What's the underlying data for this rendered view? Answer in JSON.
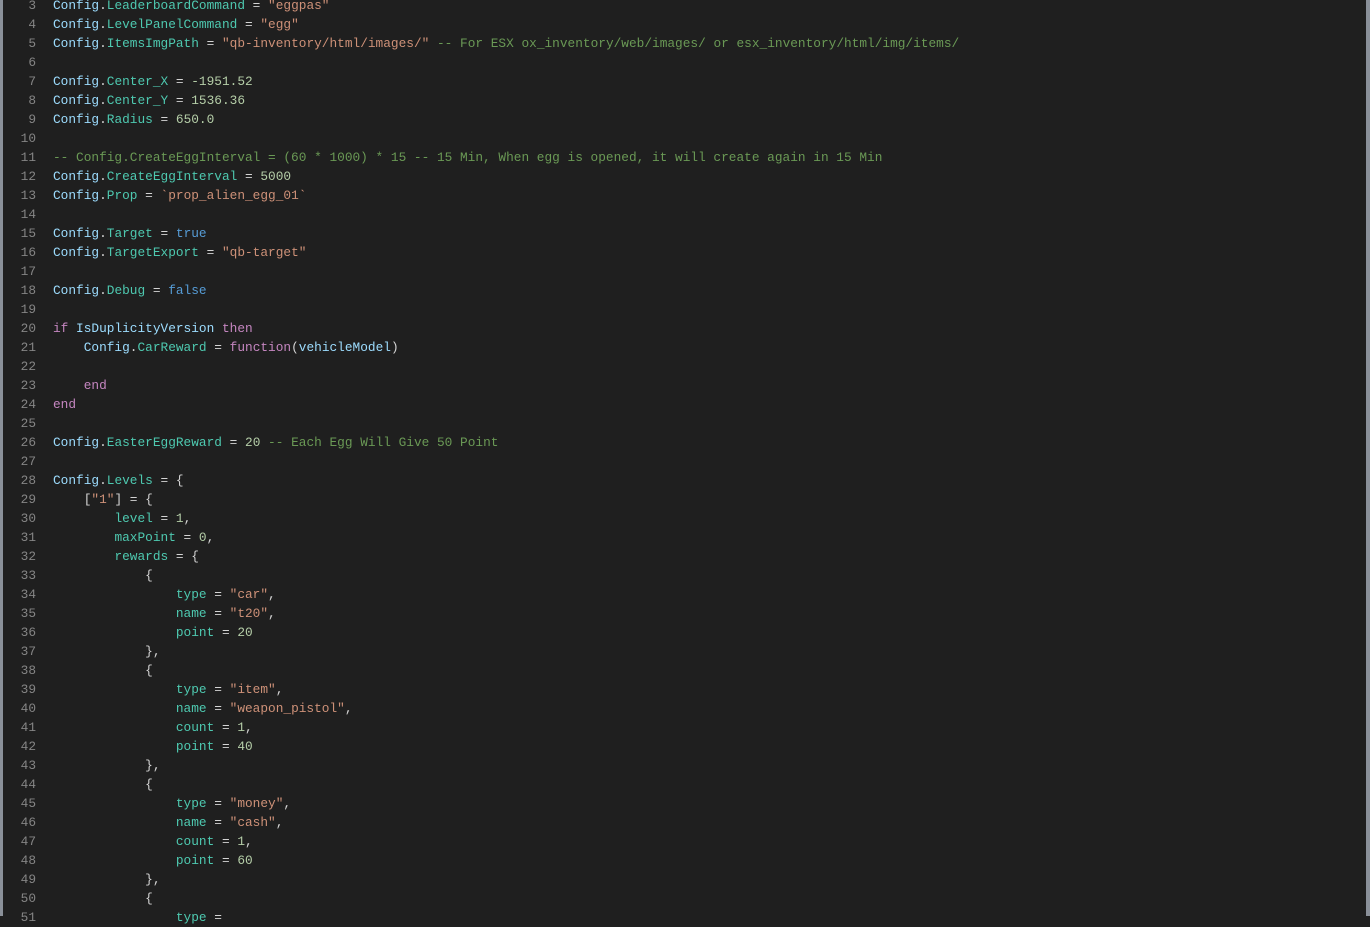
{
  "editor": {
    "first_line_number": 3,
    "lines": [
      [
        [
          "c",
          "Config"
        ],
        [
          "t",
          "."
        ],
        [
          "p",
          "LeaderboardCommand"
        ],
        [
          "t",
          " = "
        ],
        [
          "s",
          "\"eggpas\""
        ]
      ],
      [
        [
          "c",
          "Config"
        ],
        [
          "t",
          "."
        ],
        [
          "p",
          "LevelPanelCommand"
        ],
        [
          "t",
          " = "
        ],
        [
          "s",
          "\"egg\""
        ]
      ],
      [
        [
          "c",
          "Config"
        ],
        [
          "t",
          "."
        ],
        [
          "p",
          "ItemsImgPath"
        ],
        [
          "t",
          " = "
        ],
        [
          "s",
          "\"qb-inventory/html/images/\""
        ],
        [
          "m",
          " -- For ESX ox_inventory/web/images/ or esx_inventory/html/img/items/"
        ]
      ],
      [],
      [
        [
          "c",
          "Config"
        ],
        [
          "t",
          "."
        ],
        [
          "p",
          "Center_X"
        ],
        [
          "t",
          " = "
        ],
        [
          "n",
          "-1951.52"
        ]
      ],
      [
        [
          "c",
          "Config"
        ],
        [
          "t",
          "."
        ],
        [
          "p",
          "Center_Y"
        ],
        [
          "t",
          " = "
        ],
        [
          "n",
          "1536.36"
        ]
      ],
      [
        [
          "c",
          "Config"
        ],
        [
          "t",
          "."
        ],
        [
          "p",
          "Radius"
        ],
        [
          "t",
          " = "
        ],
        [
          "n",
          "650.0"
        ]
      ],
      [],
      [
        [
          "m",
          "-- Config.CreateEggInterval = (60 * 1000) * 15 -- 15 Min, When egg is opened, it will create again in 15 Min"
        ]
      ],
      [
        [
          "c",
          "Config"
        ],
        [
          "t",
          "."
        ],
        [
          "p",
          "CreateEggInterval"
        ],
        [
          "t",
          " = "
        ],
        [
          "n",
          "5000"
        ]
      ],
      [
        [
          "c",
          "Config"
        ],
        [
          "t",
          "."
        ],
        [
          "p",
          "Prop"
        ],
        [
          "t",
          " = "
        ],
        [
          "s",
          "`prop_alien_egg_01`"
        ]
      ],
      [],
      [
        [
          "c",
          "Config"
        ],
        [
          "t",
          "."
        ],
        [
          "p",
          "Target"
        ],
        [
          "t",
          " = "
        ],
        [
          "b",
          "true"
        ]
      ],
      [
        [
          "c",
          "Config"
        ],
        [
          "t",
          "."
        ],
        [
          "p",
          "TargetExport"
        ],
        [
          "t",
          " = "
        ],
        [
          "s",
          "\"qb-target\""
        ]
      ],
      [],
      [
        [
          "c",
          "Config"
        ],
        [
          "t",
          "."
        ],
        [
          "p",
          "Debug"
        ],
        [
          "t",
          " = "
        ],
        [
          "b",
          "false"
        ]
      ],
      [],
      [
        [
          "k",
          "if"
        ],
        [
          "t",
          " "
        ],
        [
          "v",
          "IsDuplicityVersion"
        ],
        [
          "t",
          " "
        ],
        [
          "k",
          "then"
        ]
      ],
      [
        [
          "t",
          "    "
        ],
        [
          "c",
          "Config"
        ],
        [
          "t",
          "."
        ],
        [
          "p",
          "CarReward"
        ],
        [
          "t",
          " = "
        ],
        [
          "k",
          "function"
        ],
        [
          "t",
          "("
        ],
        [
          "v",
          "vehicleModel"
        ],
        [
          "t",
          ")"
        ]
      ],
      [],
      [
        [
          "t",
          "    "
        ],
        [
          "k",
          "end"
        ]
      ],
      [
        [
          "k",
          "end"
        ]
      ],
      [],
      [
        [
          "c",
          "Config"
        ],
        [
          "t",
          "."
        ],
        [
          "p",
          "EasterEggReward"
        ],
        [
          "t",
          " = "
        ],
        [
          "n",
          "20"
        ],
        [
          "m",
          " -- Each Egg Will Give 50 Point"
        ]
      ],
      [],
      [
        [
          "c",
          "Config"
        ],
        [
          "t",
          "."
        ],
        [
          "p",
          "Levels"
        ],
        [
          "t",
          " = {"
        ]
      ],
      [
        [
          "t",
          "    ["
        ],
        [
          "s",
          "\"1\""
        ],
        [
          "t",
          "] = {"
        ]
      ],
      [
        [
          "t",
          "        "
        ],
        [
          "p",
          "level"
        ],
        [
          "t",
          " = "
        ],
        [
          "n",
          "1"
        ],
        [
          "t",
          ","
        ]
      ],
      [
        [
          "t",
          "        "
        ],
        [
          "p",
          "maxPoint"
        ],
        [
          "t",
          " = "
        ],
        [
          "n",
          "0"
        ],
        [
          "t",
          ","
        ]
      ],
      [
        [
          "t",
          "        "
        ],
        [
          "p",
          "rewards"
        ],
        [
          "t",
          " = {"
        ]
      ],
      [
        [
          "t",
          "            {"
        ]
      ],
      [
        [
          "t",
          "                "
        ],
        [
          "p",
          "type"
        ],
        [
          "t",
          " = "
        ],
        [
          "s",
          "\"car\""
        ],
        [
          "t",
          ","
        ]
      ],
      [
        [
          "t",
          "                "
        ],
        [
          "p",
          "name"
        ],
        [
          "t",
          " = "
        ],
        [
          "s",
          "\"t20\""
        ],
        [
          "t",
          ","
        ]
      ],
      [
        [
          "t",
          "                "
        ],
        [
          "p",
          "point"
        ],
        [
          "t",
          " = "
        ],
        [
          "n",
          "20"
        ]
      ],
      [
        [
          "t",
          "            },"
        ]
      ],
      [
        [
          "t",
          "            {"
        ]
      ],
      [
        [
          "t",
          "                "
        ],
        [
          "p",
          "type"
        ],
        [
          "t",
          " = "
        ],
        [
          "s",
          "\"item\""
        ],
        [
          "t",
          ","
        ]
      ],
      [
        [
          "t",
          "                "
        ],
        [
          "p",
          "name"
        ],
        [
          "t",
          " = "
        ],
        [
          "s",
          "\"weapon_pistol\""
        ],
        [
          "t",
          ","
        ]
      ],
      [
        [
          "t",
          "                "
        ],
        [
          "p",
          "count"
        ],
        [
          "t",
          " = "
        ],
        [
          "n",
          "1"
        ],
        [
          "t",
          ","
        ]
      ],
      [
        [
          "t",
          "                "
        ],
        [
          "p",
          "point"
        ],
        [
          "t",
          " = "
        ],
        [
          "n",
          "40"
        ]
      ],
      [
        [
          "t",
          "            },"
        ]
      ],
      [
        [
          "t",
          "            {"
        ]
      ],
      [
        [
          "t",
          "                "
        ],
        [
          "p",
          "type"
        ],
        [
          "t",
          " = "
        ],
        [
          "s",
          "\"money\""
        ],
        [
          "t",
          ","
        ]
      ],
      [
        [
          "t",
          "                "
        ],
        [
          "p",
          "name"
        ],
        [
          "t",
          " = "
        ],
        [
          "s",
          "\"cash\""
        ],
        [
          "t",
          ","
        ]
      ],
      [
        [
          "t",
          "                "
        ],
        [
          "p",
          "count"
        ],
        [
          "t",
          " = "
        ],
        [
          "n",
          "1"
        ],
        [
          "t",
          ","
        ]
      ],
      [
        [
          "t",
          "                "
        ],
        [
          "p",
          "point"
        ],
        [
          "t",
          " = "
        ],
        [
          "n",
          "60"
        ]
      ],
      [
        [
          "t",
          "            },"
        ]
      ],
      [
        [
          "t",
          "            {"
        ]
      ],
      [
        [
          "t",
          "                "
        ],
        [
          "p",
          "type"
        ],
        [
          "t",
          " = "
        ]
      ]
    ]
  }
}
